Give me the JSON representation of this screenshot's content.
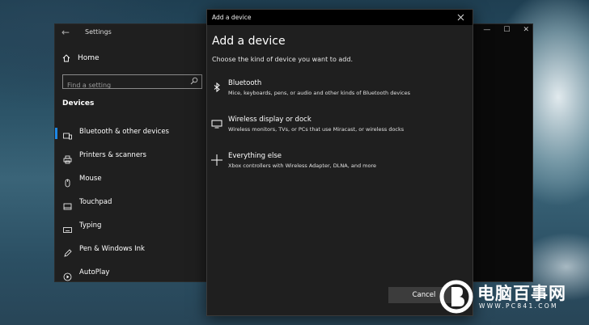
{
  "settings_window": {
    "title": "Settings",
    "home_label": "Home",
    "search": {
      "placeholder": "Find a setting"
    },
    "section_heading": "Devices",
    "nav_items": [
      {
        "label": "Bluetooth & other devices",
        "icon": "bluetooth-devices-icon",
        "selected": true
      },
      {
        "label": "Printers & scanners",
        "icon": "printer-icon",
        "selected": false
      },
      {
        "label": "Mouse",
        "icon": "mouse-icon",
        "selected": false
      },
      {
        "label": "Touchpad",
        "icon": "touchpad-icon",
        "selected": false
      },
      {
        "label": "Typing",
        "icon": "keyboard-icon",
        "selected": false
      },
      {
        "label": "Pen & Windows Ink",
        "icon": "pen-icon",
        "selected": false
      },
      {
        "label": "AutoPlay",
        "icon": "autoplay-icon",
        "selected": false
      }
    ],
    "accent_color": "#1e88e5"
  },
  "dialog": {
    "titlebar": "Add a device",
    "heading": "Add a device",
    "subtitle": "Choose the kind of device you want to add.",
    "options": [
      {
        "title": "Bluetooth",
        "description": "Mice, keyboards, pens, or audio and other kinds of Bluetooth devices",
        "icon": "bluetooth-icon"
      },
      {
        "title": "Wireless display or dock",
        "description": "Wireless monitors, TVs, or PCs that use Miracast, or wireless docks",
        "icon": "monitor-icon"
      },
      {
        "title": "Everything else",
        "description": "Xbox controllers with Wireless Adapter, DLNA, and more",
        "icon": "plus-icon"
      }
    ],
    "cancel_label": "Cancel"
  },
  "watermark": {
    "title": "电脑百事网",
    "url": "WWW.PC841.COM"
  }
}
